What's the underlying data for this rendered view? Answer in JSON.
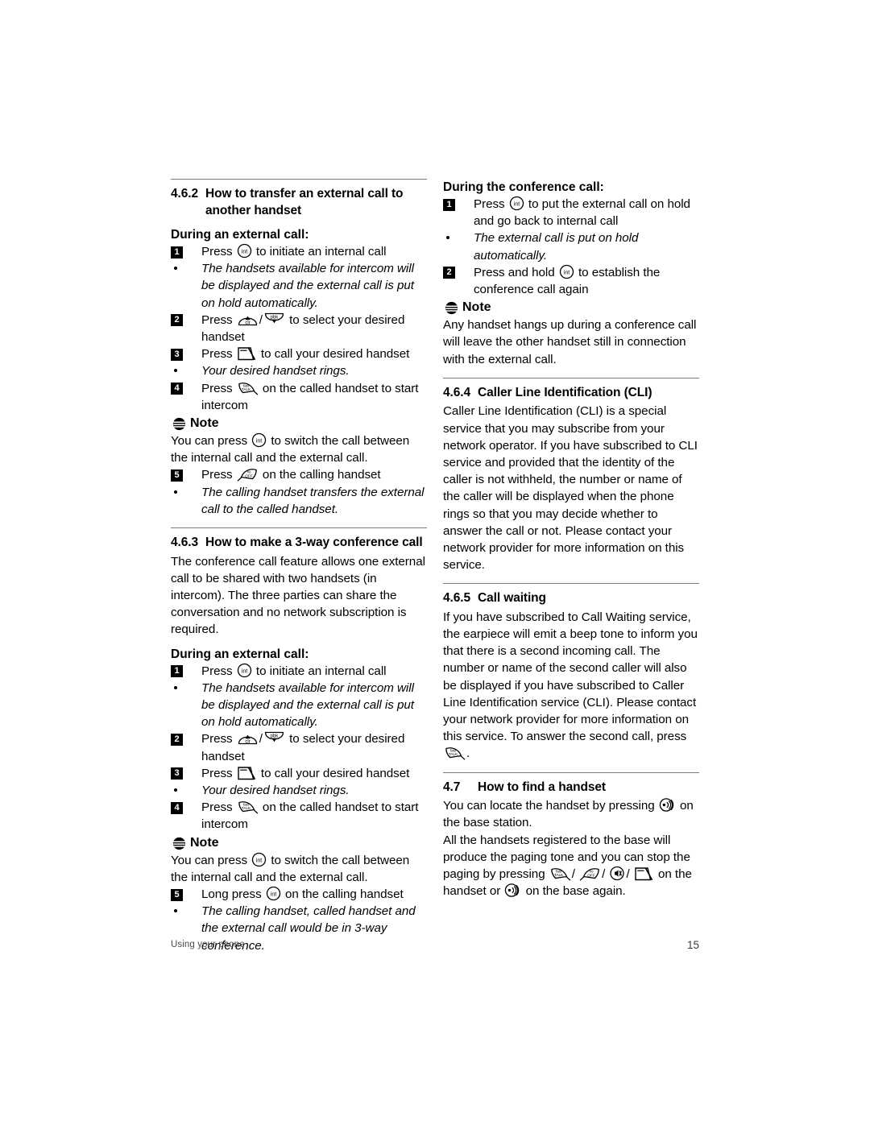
{
  "footer": {
    "left_text": "Using your phone",
    "page_number": "15"
  },
  "icons": {
    "int": "int-key-icon",
    "clr_up": "up-clr-key-icon",
    "pbk_down": "down-pbk-key-icon",
    "call": "call-key-icon",
    "talk": "talk-key-icon",
    "off": "off-key-icon",
    "mute": "mute-key-icon",
    "paging": "paging-key-icon",
    "note": "note-icon"
  },
  "left_column": {
    "section_462": {
      "number": "4.6.2",
      "title": "How to transfer an external call to another handset",
      "title_line1": "How to transfer an external call to",
      "title_line2": "another handset",
      "subheading": "During an external call:",
      "steps": [
        {
          "marker": "1",
          "text_before": "Press",
          "icon": "int",
          "text_after": "to initiate an internal call"
        },
        {
          "marker": "•",
          "italic": true,
          "text": "The handsets available for intercom will be displayed and the external call is put on hold automatically."
        },
        {
          "marker": "2",
          "text_before": "Press",
          "icon": "clr_up",
          "sep": "/",
          "icon2": "pbk_down",
          "text_after": "to select your desired handset"
        },
        {
          "marker": "3",
          "text_before": "Press",
          "icon": "call",
          "text_after": "to call your desired handset"
        },
        {
          "marker": "•",
          "italic": true,
          "text": "Your desired handset rings."
        },
        {
          "marker": "4",
          "text_before": "Press",
          "icon": "talk",
          "text_after": "on the called handset to start intercom"
        }
      ],
      "note_label": "Note",
      "note_text_before": "You can press",
      "note_icon": "int",
      "note_text_after": "to switch the call between the internal call and the external call.",
      "steps_after_note": [
        {
          "marker": "5",
          "text_before": "Press",
          "icon": "off",
          "text_after": "on the calling handset"
        },
        {
          "marker": "•",
          "italic": true,
          "text": "The calling handset transfers the external call to the called handset."
        }
      ]
    },
    "section_463": {
      "number": "4.6.3",
      "title": "How to make a 3-way conference call",
      "paragraph": "The conference call feature allows one external call to be shared with two handsets (in intercom). The three parties can share the conversation and no network subscription is required.",
      "subheading": "During an external call:",
      "steps": [
        {
          "marker": "1",
          "text_before": "Press",
          "icon": "int",
          "text_after": "to initiate an internal call"
        },
        {
          "marker": "•",
          "italic": true,
          "text": "The handsets available for intercom will be displayed and the external call is put on hold automatically."
        },
        {
          "marker": "2",
          "text_before": "Press",
          "icon": "clr_up",
          "sep": "/",
          "icon2": "pbk_down",
          "text_after": "to select your desired handset"
        },
        {
          "marker": "3",
          "text_before": "Press",
          "icon": "call",
          "text_after": "to call your desired handset"
        },
        {
          "marker": "•",
          "italic": true,
          "text": "Your desired handset rings."
        },
        {
          "marker": "4",
          "text_before": "Press",
          "icon": "talk",
          "text_after": "on the called handset to start intercom"
        }
      ],
      "note_label": "Note",
      "note_text_before": "You can press",
      "note_icon": "int",
      "note_text_after": "to switch the call between the internal call and the external call.",
      "steps_after_note": [
        {
          "marker": "5",
          "text_before": "Long press",
          "icon": "int",
          "text_after": "on the calling handset"
        },
        {
          "marker": "•",
          "italic": true,
          "text": "The calling handset, called handset and the external call would be in 3-way conference."
        }
      ]
    }
  },
  "right_column": {
    "conference_block": {
      "subheading": "During the conference call:",
      "steps": [
        {
          "marker": "1",
          "text_before": "Press",
          "icon": "int",
          "text_after": "to put the external call on hold and go back to internal call"
        },
        {
          "marker": "•",
          "italic": true,
          "text": "The external call is put on hold automatically."
        },
        {
          "marker": "2",
          "text_before": "Press and hold",
          "icon": "int",
          "text_after": "to establish the conference call again"
        }
      ],
      "note_label": "Note",
      "note_text": "Any handset hangs up during a conference call will leave the other handset still in connection with the external call."
    },
    "section_464": {
      "number": "4.6.4",
      "title": "Caller Line Identification (CLI)",
      "paragraph": "Caller Line Identification (CLI) is a special service that you may subscribe from your network operator.  If you have subscribed to CLI service and provided that the identity of the caller is not withheld, the number or name of the caller will be displayed when the phone rings so that you may decide whether to answer the call or not.  Please contact your network provider for more information on this service."
    },
    "section_465": {
      "number": "4.6.5",
      "title": "Call waiting",
      "paragraph_1": "If you have subscribed to Call Waiting service, the earpiece will emit a beep tone to inform you that there is a second incoming call.  The number or name of the second caller will also be displayed if you have subscribed to Caller Line Identification service (CLI).  Please contact your network provider for more information on this service.",
      "paragraph_2_before": "To answer the second call, press",
      "paragraph_2_icon": "talk",
      "paragraph_2_after": "."
    },
    "section_47": {
      "number": "4.7",
      "title": "How to find a handset",
      "paragraph_1_before": "You can locate the handset by pressing",
      "paragraph_1_icon": "paging",
      "paragraph_1_after": "on the base station.",
      "paragraph_2_before": "All the handsets registered to the base will produce the paging tone and you can stop the paging by pressing",
      "paragraph_2_icons": [
        "talk",
        "off",
        "mute",
        "call"
      ],
      "paragraph_2_mid": "on the handset or",
      "paragraph_2_icon_last": "paging",
      "paragraph_2_after": "on the base again."
    }
  }
}
